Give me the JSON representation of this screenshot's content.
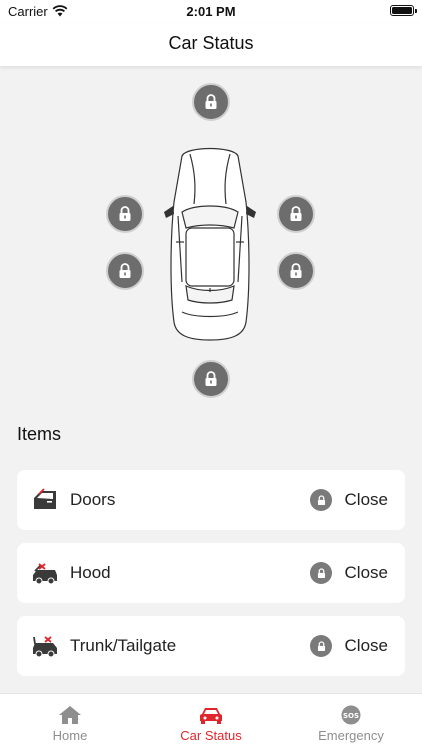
{
  "status_bar": {
    "carrier": "Carrier",
    "time": "2:01 PM"
  },
  "nav": {
    "title": "Car Status"
  },
  "car_locks": [
    "front",
    "left-front",
    "left-rear",
    "right-front",
    "right-rear",
    "rear"
  ],
  "items_section": {
    "title": "Items",
    "items": [
      {
        "label": "Doors",
        "status": "Close",
        "icon": "door-icon"
      },
      {
        "label": "Hood",
        "status": "Close",
        "icon": "hood-icon"
      },
      {
        "label": "Trunk/Tailgate",
        "status": "Close",
        "icon": "trunk-icon"
      }
    ]
  },
  "tabs": [
    {
      "label": "Home",
      "icon": "home-icon",
      "active": false
    },
    {
      "label": "Car Status",
      "icon": "car-icon",
      "active": true
    },
    {
      "label": "Emergency",
      "icon": "sos-icon",
      "active": false
    }
  ],
  "colors": {
    "accent": "#e0262c",
    "lock": "#6d6d6d",
    "inactive_tab": "#8e8e8e"
  }
}
